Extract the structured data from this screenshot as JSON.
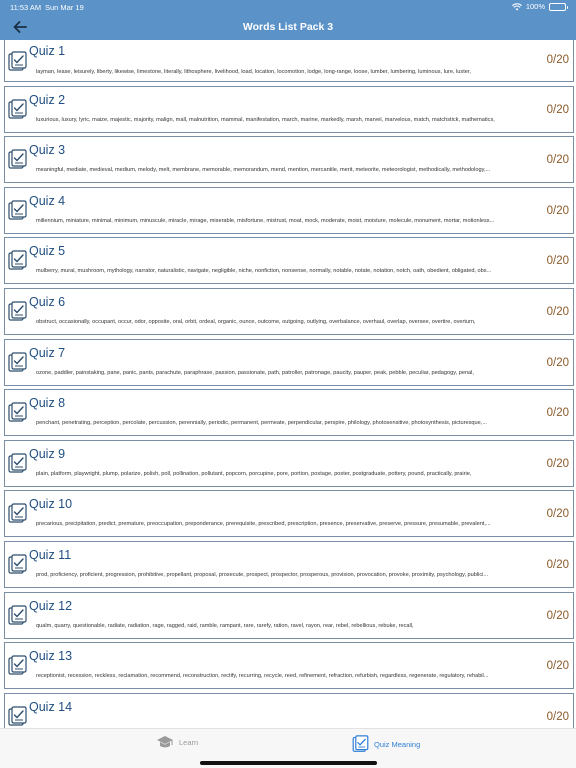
{
  "status_bar": {
    "time": "11:53 AM",
    "date": "Sun Mar 19",
    "battery": "100%"
  },
  "nav": {
    "title": "Words List Pack 3",
    "back_icon": "arrow-left-icon"
  },
  "quizzes": [
    {
      "title": "Quiz 1",
      "score": "0/20",
      "words": "layman, lease, leisurely, liberty, likewise, limestone, literally, lithosphere, livelihood, load, location, locomotion, lodge, long-range, loose, lumber, lumbering, luminous, lure, luster,"
    },
    {
      "title": "Quiz 2",
      "score": "0/20",
      "words": "luxurious, luxury, lyric, maize, majestic, majority, malign, mall, malnutrition, mammal, manifestation, march, marine, markedly, marsh, marvel, marvelous, match, matchstick, mathematics,"
    },
    {
      "title": "Quiz 3",
      "score": "0/20",
      "words": "meaningful, mediate, medieval, medium, melody, melt, membrane, memorable, memorandum, mend, mention, mercantile, merit, meteorite, meteorologist, methodically, methodology,..."
    },
    {
      "title": "Quiz 4",
      "score": "0/20",
      "words": "millennium, miniature, minimal, minimum, minuscule, miracle, mirage, miserable, misfortune, mistrust, moat, mock, moderate, moist, moisture, molecule, monument, mortar, motionless..."
    },
    {
      "title": "Quiz 5",
      "score": "0/20",
      "words": "mulberry, mural, mushroom, mythology, narrator, naturalistic, navigate, negligible, niche, nonfiction, nonsense, normally, notable, notate, notation, notch, oath, obedient, obligated, obs..."
    },
    {
      "title": "Quiz 6",
      "score": "0/20",
      "words": "obstruct, occasionally, occupant, occur, odor, opposite, oral, orbit, ordeal, organic, ounce, outcome, outgoing, outlying, overbalance, overhaul, overlap, oversee, overtire, overturn,"
    },
    {
      "title": "Quiz 7",
      "score": "0/20",
      "words": "ozone, paddler, painstaking, pane, panic, pants, parachute, paraphrase, passion, passionate, path, patroller, patronage, paucity, pauper, peak, pebble, peculiar, pedagogy, penal,"
    },
    {
      "title": "Quiz 8",
      "score": "0/20",
      "words": "penchant, penetrating, perception, percolate, percussion, perennially, periodic, permanent, permeate, perpendicular, perspire, philology, photosensitive, photosynthesis, picturesque,..."
    },
    {
      "title": "Quiz 9",
      "score": "0/20",
      "words": "plain, platform, playwright, plump, polarize, polish, poll, pollination, pollutant, popcorn, porcupine, pore, portion, postage, poster, postgraduate, pottery, pound, practically, prairie,"
    },
    {
      "title": "Quiz 10",
      "score": "0/20",
      "words": "precarious, precipitation, predict, premature, preoccupation, preponderance, prerequisite, prescribed, prescription, presence, preservative, preserve, pressure, presumable, prevalent,..."
    },
    {
      "title": "Quiz 11",
      "score": "0/20",
      "words": "prod, proficiency, proficient, progression, prohibitive, propellant, proposal, prosecute, prospect, prospector, prosperous, provision, provocation, provoke, proximity, psychology, publici..."
    },
    {
      "title": "Quiz 12",
      "score": "0/20",
      "words": "qualm, quarry, questionable, radiate, radiation, rage, ragged, raid, ramble, rampant, rare, rarefy, ration, ravel, rayon, rear, rebel, rebellious, rebuke, recall,"
    },
    {
      "title": "Quiz 13",
      "score": "0/20",
      "words": "receptionist, recession, reckless, reclamation, recommend, reconstruction, rectify, recurring, recycle, reed, refinement, refraction, refurbish, regardless, regenerate, regulatory, rehabil..."
    },
    {
      "title": "Quiz 14",
      "score": "0/20",
      "words": ""
    }
  ],
  "tabs": {
    "learn": {
      "label": "Learn",
      "icon": "graduation-cap-icon",
      "color": "#9a9a9a"
    },
    "quiz_meaning": {
      "label": "Quiz Meaning",
      "icon": "quiz-document-icon",
      "color": "#2f7fd6"
    }
  },
  "colors": {
    "header": "#5b93c9",
    "quiz_title": "#1f4f83",
    "score": "#8a5a2a",
    "row_border": "#7a8fa3"
  }
}
